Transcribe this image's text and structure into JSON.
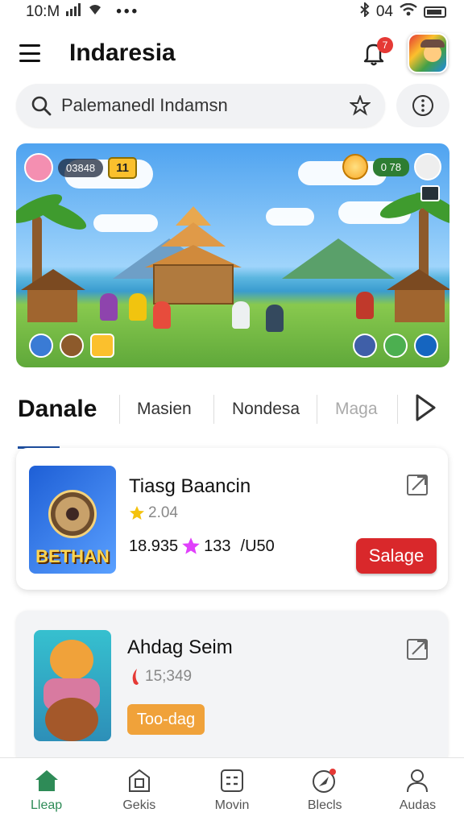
{
  "status_bar": {
    "time": "10:M",
    "signal": "4",
    "right_text": "04"
  },
  "header": {
    "title": "Indaresia",
    "notification_count": "7"
  },
  "search": {
    "text": "Palemanedl Indamsn"
  },
  "banner": {
    "score": "03848",
    "level": "11",
    "coins": "0 78"
  },
  "tabs": [
    {
      "label": "Danale",
      "active": true
    },
    {
      "label": "Masien"
    },
    {
      "label": "Nondesa"
    },
    {
      "label": "Maga"
    }
  ],
  "cards": [
    {
      "title": "Tiasg Baancin",
      "rating": "2.04",
      "stats_left": "18.935",
      "stats_mid": "133",
      "stats_right": "/U50",
      "button": "Salage",
      "logo_text": "BETHAN"
    },
    {
      "title": "Ahdag Seim",
      "rating": "15;349",
      "button": "Too-dag"
    }
  ],
  "bottom_nav": [
    {
      "label": "Lleap",
      "icon": "home-icon",
      "active": true
    },
    {
      "label": "Gekis",
      "icon": "store-icon"
    },
    {
      "label": "Movin",
      "icon": "grid-icon"
    },
    {
      "label": "Blecls",
      "icon": "rocket-icon"
    },
    {
      "label": "Audas",
      "icon": "profile-icon"
    }
  ],
  "colors": {
    "accent_red": "#d9282b",
    "accent_orange": "#f0a23a",
    "nav_active": "#2e8b57",
    "tab_underline": "#1e4fa0"
  }
}
